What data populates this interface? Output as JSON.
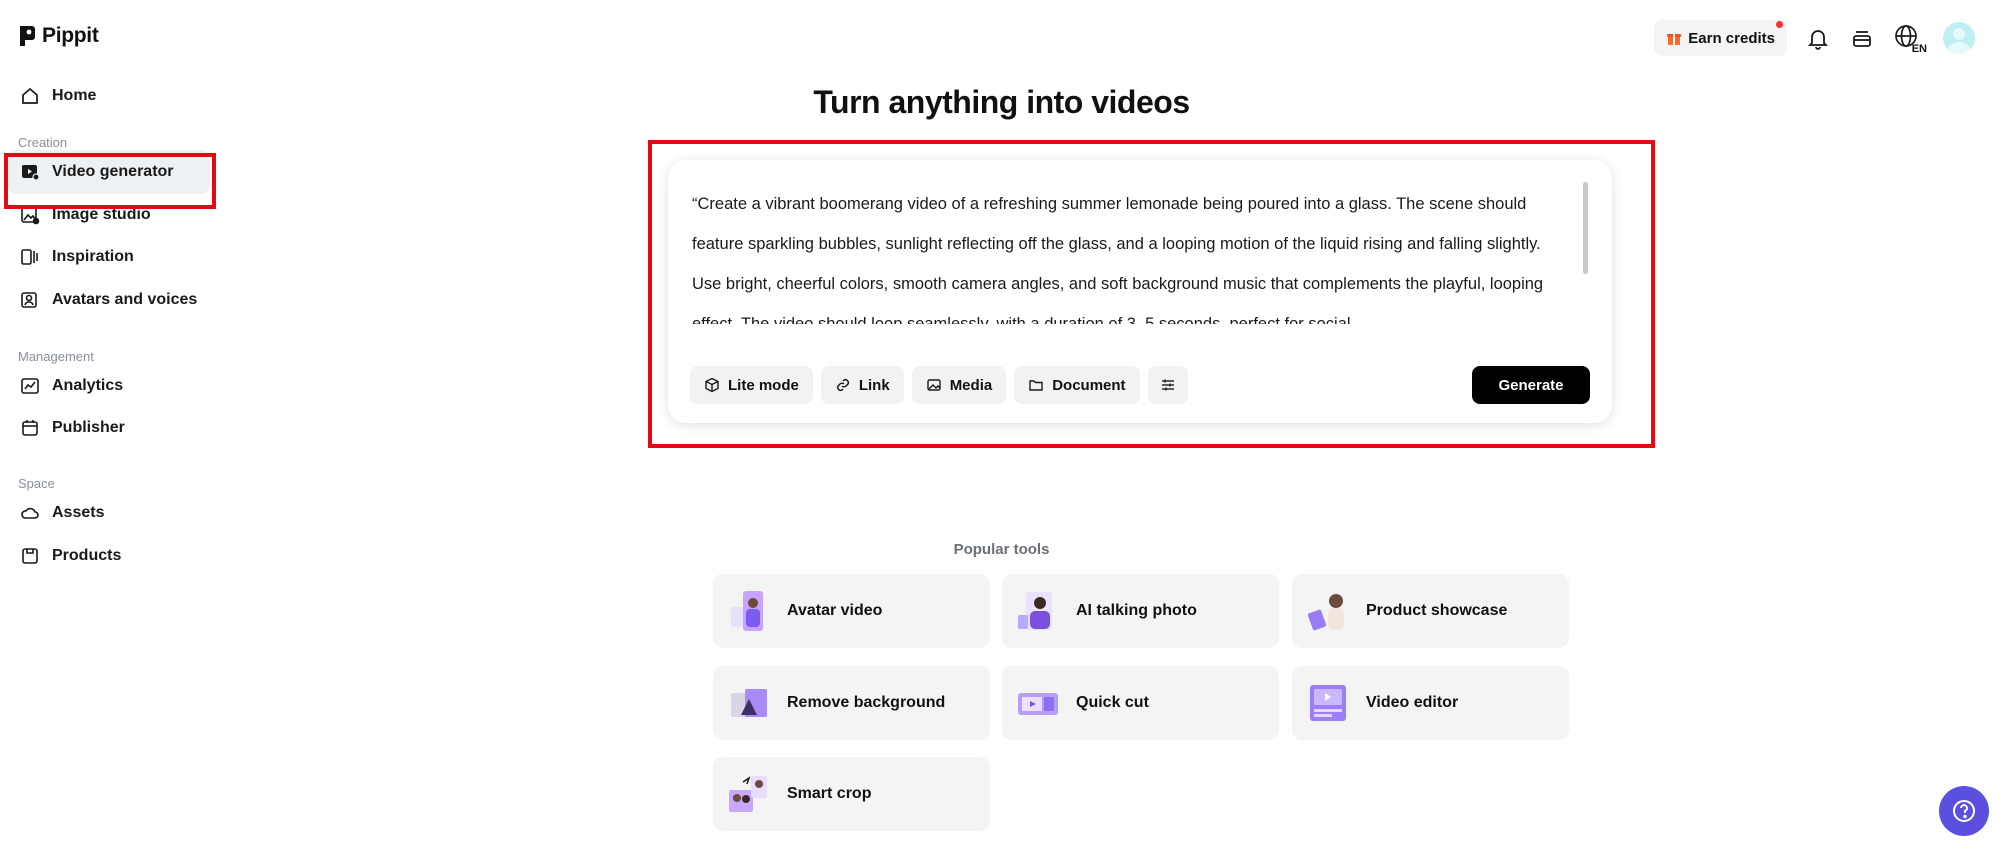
{
  "brand": {
    "name": "Pippit"
  },
  "sidebar": {
    "home": "Home",
    "sections": {
      "creation": "Creation",
      "management": "Management",
      "space": "Space"
    },
    "creation_items": [
      "Video generator",
      "Image studio",
      "Inspiration",
      "Avatars and voices"
    ],
    "management_items": [
      "Analytics",
      "Publisher"
    ],
    "space_items": [
      "Assets",
      "Products"
    ],
    "active_item": "Video generator"
  },
  "topbar": {
    "earn_credits": "Earn credits",
    "language": "EN"
  },
  "main": {
    "title": "Turn anything into videos",
    "prompt_text": "“Create a vibrant boomerang video of a refreshing summer lemonade being poured into a glass. The scene should feature sparkling bubbles, sunlight reflecting off the glass, and a looping motion of the liquid rising and falling slightly. Use bright, cheerful colors, smooth camera angles, and soft background music that complements the playful, looping effect. The video should loop seamlessly, with a duration of 3–5 seconds, perfect for social",
    "chips": {
      "lite_mode": "Lite mode",
      "link": "Link",
      "media": "Media",
      "document": "Document"
    },
    "generate": "Generate",
    "popular_label": "Popular tools",
    "tools": [
      "Avatar video",
      "AI talking photo",
      "Product showcase",
      "Remove background",
      "Quick cut",
      "Video editor",
      "Smart crop"
    ]
  },
  "colors": {
    "highlight": "#e50914",
    "accent": "#5b4fe0",
    "generate_bg": "#000000"
  }
}
